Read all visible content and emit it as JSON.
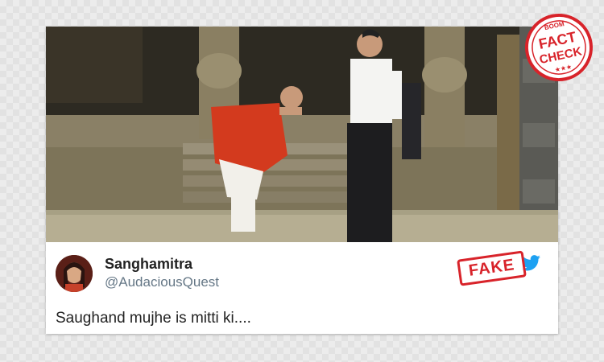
{
  "tweet": {
    "display_name": "Sanghamitra",
    "handle": "@AudaciousQuest",
    "text": "Saughand mujhe is mitti ki...."
  },
  "stamps": {
    "fake_label": "FAKE",
    "badge_top": "BOOM",
    "badge_line1": "FACT",
    "badge_line2": "CHECK"
  },
  "colors": {
    "stamp_red": "#d8232a",
    "twitter_blue": "#1da1f2",
    "handle_gray": "#657786"
  },
  "icons": [
    "twitter-bird-icon"
  ]
}
